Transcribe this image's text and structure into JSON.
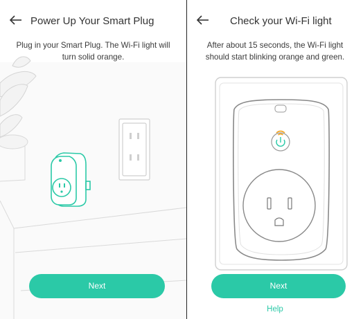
{
  "left_screen": {
    "title": "Power Up Your Smart Plug",
    "instruction": "Plug in your Smart Plug. The Wi-Fi light will turn solid orange.",
    "next_label": "Next",
    "back_icon": "back-arrow-icon"
  },
  "right_screen": {
    "title": "Check your Wi-Fi light",
    "instruction": "After about 15 seconds, the Wi-Fi light should start blinking orange and green.",
    "next_label": "Next",
    "help_label": "Help",
    "back_icon": "back-arrow-icon"
  },
  "colors": {
    "accent": "#2bc9a7",
    "wifi_led": "#f5a623",
    "text": "#333333"
  }
}
